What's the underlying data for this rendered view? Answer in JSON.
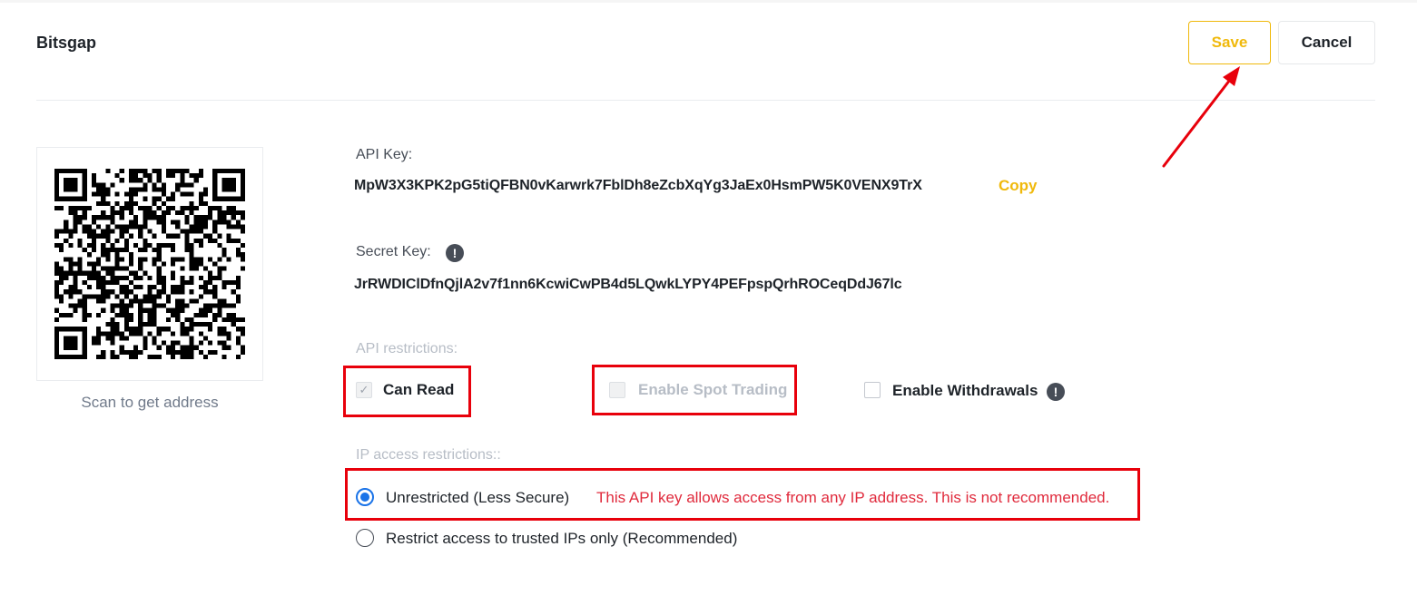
{
  "header": {
    "title": "Bitsgap",
    "save_label": "Save",
    "cancel_label": "Cancel"
  },
  "qr": {
    "caption": "Scan to get address"
  },
  "api_key": {
    "label": "API Key:",
    "value": "MpW3X3KPK2pG5tiQFBN0vKarwrk7FblDh8eZcbXqYg3JaEx0HsmPW5K0VENX9TrX",
    "copy_label": "Copy"
  },
  "secret_key": {
    "label": "Secret Key:",
    "value": "JrRWDIClDfnQjlA2v7f1nn6KcwiCwPB4d5LQwkLYPY4PEFpspQrhROCeqDdJ67lc",
    "info_icon": "!"
  },
  "api_restrictions": {
    "label": "API restrictions:",
    "options": [
      {
        "label": "Can Read",
        "checked": true,
        "disabled": true
      },
      {
        "label": "Enable Spot Trading",
        "checked": false,
        "disabled": true
      },
      {
        "label": "Enable Withdrawals",
        "checked": false,
        "disabled": false
      }
    ],
    "withdraw_info_icon": "!"
  },
  "ip_restrictions": {
    "label": "IP access restrictions::",
    "options": [
      {
        "label": "Unrestricted (Less Secure)",
        "selected": true
      },
      {
        "label": "Restrict access to trusted IPs only (Recommended)",
        "selected": false
      }
    ],
    "warning": "This API key allows access from any IP address. This is not recommended."
  },
  "colors": {
    "accent": "#f0b90b",
    "warning": "#e02a3c",
    "radio_selected": "#1a73e8",
    "annotation": "#e8000b"
  }
}
